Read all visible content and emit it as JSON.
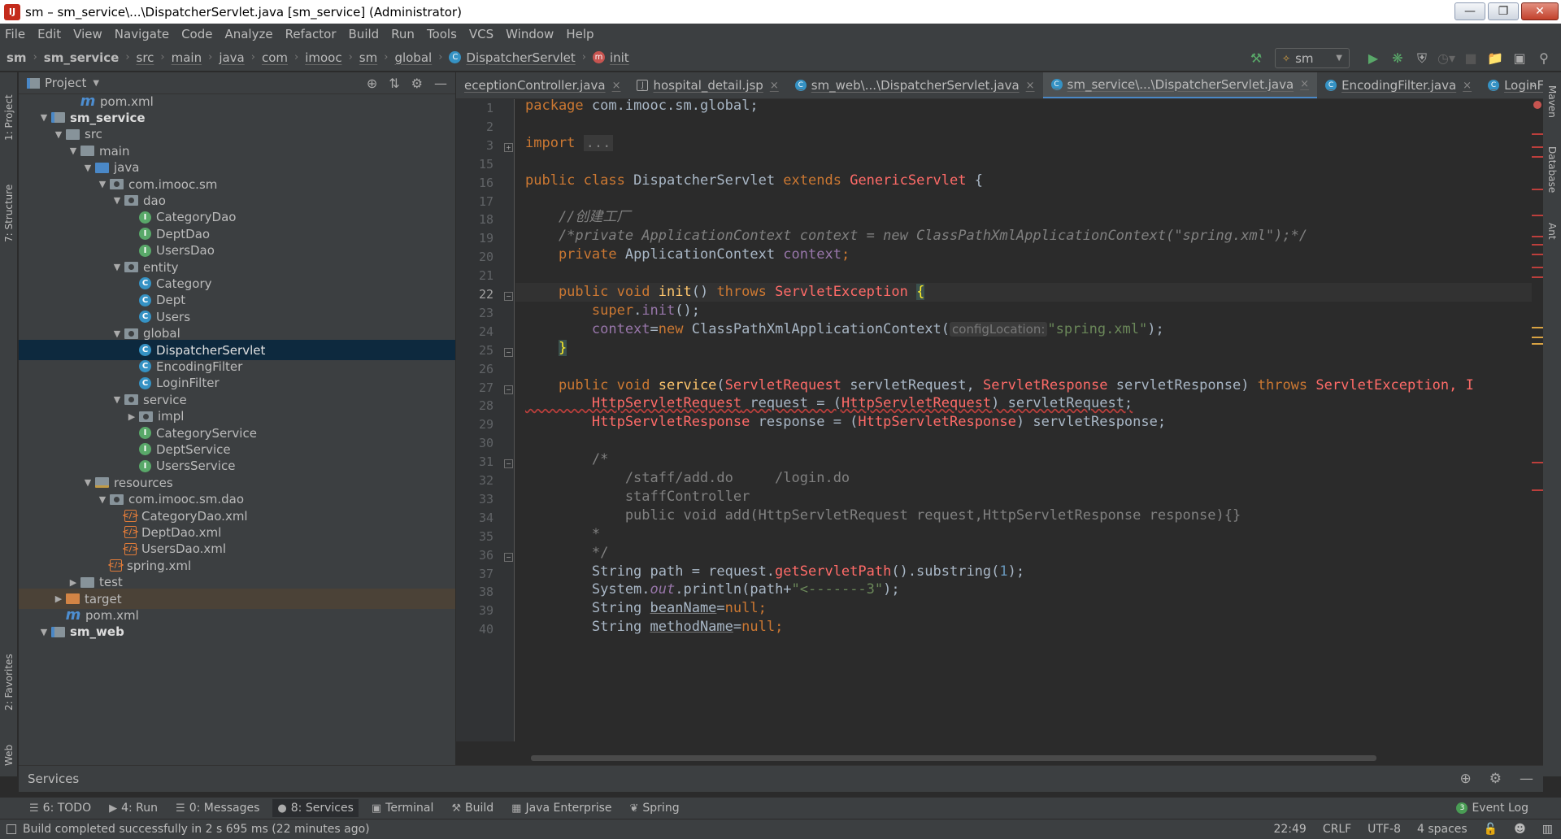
{
  "window": {
    "title": "sm – sm_service\\...\\DispatcherServlet.java [sm_service] (Administrator)",
    "app_icon": "IJ"
  },
  "menu": [
    "File",
    "Edit",
    "View",
    "Navigate",
    "Code",
    "Analyze",
    "Refactor",
    "Build",
    "Run",
    "Tools",
    "VCS",
    "Window",
    "Help"
  ],
  "breadcrumbs": [
    "sm",
    "sm_service",
    "src",
    "main",
    "java",
    "com",
    "imooc",
    "sm",
    "global",
    "DispatcherServlet",
    "init"
  ],
  "run_config": "sm",
  "project_panel": {
    "title": "Project"
  },
  "tree": [
    {
      "indent": 3,
      "icon": "mvn",
      "label": "pom.xml"
    },
    {
      "indent": 1,
      "icon": "mod",
      "label": "sm_service",
      "arrow": "▼",
      "bold": true
    },
    {
      "indent": 2,
      "icon": "folder",
      "label": "src",
      "arrow": "▼"
    },
    {
      "indent": 3,
      "icon": "folder",
      "label": "main",
      "arrow": "▼"
    },
    {
      "indent": 4,
      "icon": "srcf",
      "label": "java",
      "arrow": "▼"
    },
    {
      "indent": 5,
      "icon": "pkg",
      "label": "com.imooc.sm",
      "arrow": "▼"
    },
    {
      "indent": 6,
      "icon": "pkg",
      "label": "dao",
      "arrow": "▼"
    },
    {
      "indent": 7,
      "icon": "itf",
      "label": "CategoryDao"
    },
    {
      "indent": 7,
      "icon": "itf",
      "label": "DeptDao"
    },
    {
      "indent": 7,
      "icon": "itf",
      "label": "UsersDao"
    },
    {
      "indent": 6,
      "icon": "pkg",
      "label": "entity",
      "arrow": "▼"
    },
    {
      "indent": 7,
      "icon": "cls",
      "label": "Category"
    },
    {
      "indent": 7,
      "icon": "cls",
      "label": "Dept"
    },
    {
      "indent": 7,
      "icon": "cls",
      "label": "Users"
    },
    {
      "indent": 6,
      "icon": "pkg",
      "label": "global",
      "arrow": "▼"
    },
    {
      "indent": 7,
      "icon": "cls",
      "label": "DispatcherServlet",
      "selected": true
    },
    {
      "indent": 7,
      "icon": "cls",
      "label": "EncodingFilter"
    },
    {
      "indent": 7,
      "icon": "cls",
      "label": "LoginFilter"
    },
    {
      "indent": 6,
      "icon": "pkg",
      "label": "service",
      "arrow": "▼"
    },
    {
      "indent": 7,
      "icon": "pkg",
      "label": "impl",
      "arrow": "▶"
    },
    {
      "indent": 7,
      "icon": "itf",
      "label": "CategoryService"
    },
    {
      "indent": 7,
      "icon": "itf",
      "label": "DeptService"
    },
    {
      "indent": 7,
      "icon": "itf",
      "label": "UsersService"
    },
    {
      "indent": 4,
      "icon": "resf",
      "label": "resources",
      "arrow": "▼"
    },
    {
      "indent": 5,
      "icon": "pkg",
      "label": "com.imooc.sm.dao",
      "arrow": "▼"
    },
    {
      "indent": 6,
      "icon": "xml",
      "label": "CategoryDao.xml"
    },
    {
      "indent": 6,
      "icon": "xml",
      "label": "DeptDao.xml"
    },
    {
      "indent": 6,
      "icon": "xml",
      "label": "UsersDao.xml"
    },
    {
      "indent": 5,
      "icon": "xml",
      "label": "spring.xml"
    },
    {
      "indent": 3,
      "icon": "folder",
      "label": "test",
      "arrow": "▶"
    },
    {
      "indent": 2,
      "icon": "orange",
      "label": "target",
      "arrow": "▶",
      "highlight": true
    },
    {
      "indent": 2,
      "icon": "mvn",
      "label": "pom.xml"
    },
    {
      "indent": 1,
      "icon": "mod",
      "label": "sm_web",
      "arrow": "▼",
      "bold": true
    }
  ],
  "editor_tabs": [
    {
      "label": "eceptionController.java",
      "icon": "C"
    },
    {
      "label": "hospital_detail.jsp",
      "icon": "jsp"
    },
    {
      "label": "sm_web\\...\\DispatcherServlet.java",
      "icon": "C"
    },
    {
      "label": "sm_service\\...\\DispatcherServlet.java",
      "icon": "C",
      "active": true
    },
    {
      "label": "EncodingFilter.java",
      "icon": "C"
    },
    {
      "label": "LoginFilter.java",
      "icon": "C"
    }
  ],
  "line_numbers": [
    "1",
    "2",
    "3",
    "15",
    "16",
    "17",
    "18",
    "19",
    "20",
    "21",
    "22",
    "23",
    "24",
    "25",
    "26",
    "27",
    "28",
    "29",
    "30",
    "31",
    "32",
    "33",
    "34",
    "35",
    "36",
    "37",
    "38",
    "39",
    "40"
  ],
  "code": {
    "l1_kw": "package",
    "l1_rest": " com.imooc.sm.global;",
    "l3_kw": "import",
    "l3_dots": "...",
    "l16_a": "public class",
    "l16_b": " DispatcherServlet ",
    "l16_c": "extends",
    "l16_d": "GenericServlet",
    "l16_e": " {",
    "l18": "    //创建工厂",
    "l19": "    /*private ApplicationContext context = new ClassPathXmlApplicationContext(\"spring.xml\");*/",
    "l20_kw": "    private",
    "l20_type": " ApplicationContext ",
    "l20_fld": "context",
    ";": ";",
    "l22_kw": "    public void ",
    "l22_fn": "init",
    "l22_p": "() ",
    "l22_kw2": "throws ",
    "l22_ex": "ServletException ",
    "l22_br": "{",
    "l23_kw": "        super",
    "l23_dot": ".",
    "l23_fn": "init",
    "l23_p": "();",
    "l24_fld": "        context",
    "l24_eq": "=",
    "l24_kw": "new ",
    "l24_cls": "ClassPathXmlApplicationContext(",
    "l24_hint": "configLocation:",
    "l24_str": "\"spring.xml\"",
    "l24_end": ");",
    "l25_br": "}",
    "l27_kw": "    public void ",
    "l27_fn": "service",
    "l27_p1": "(",
    "l27_t1": "ServletRequest",
    "l27_v1": " servletRequest, ",
    "l27_t2": "ServletResponse",
    "l27_v2": " servletResponse) ",
    "l27_kw2": "throws ",
    "l27_ex": "ServletException, I",
    "l28_t": "        HttpServletRequest",
    "l28_v": " request = (",
    "l28_t2": "HttpServletRequest",
    "l28_v2": ") servletRequest;",
    "l29_t": "        HttpServletResponse",
    "l29_v": " response = (",
    "l29_t2": "HttpServletResponse",
    "l29_v2": ") servletResponse;",
    "l31": "        /*",
    "l32": "            /staff/add.do     /login.do",
    "l33": "            staffController",
    "l34": "            public void add(HttpServletRequest request,HttpServletResponse response){}",
    "l35": "        *",
    "l36": "        */",
    "l37_a": "        String path = request.",
    "l37_fn": "getServletPath",
    "l37_b": "().substring(",
    "l37_n": "1",
    "l37_c": ");",
    "l38_a": "        System.",
    "l38_f": "out",
    "l38_b": ".println(path+",
    "l38_s": "\"<-------3\"",
    "l38_c": ");",
    "l39_a": "        String ",
    "l39_v": "beanName",
    "l39_b": "=",
    "l39_n": "null",
    "l40_a": "        String ",
    "l40_v": "methodName",
    "l40_b": "=",
    "l40_n": "null",
    "l40_c": ";"
  },
  "left_tool_tabs": [
    "1: Project",
    "7: Structure",
    "2: Favorites",
    "Web"
  ],
  "right_tool_tabs": [
    "Maven",
    "Database",
    "Ant"
  ],
  "services_bar": {
    "title": "Services"
  },
  "bottom_tabs": [
    {
      "label": "6: TODO",
      "icon": "☰"
    },
    {
      "label": "4: Run",
      "icon": "▶"
    },
    {
      "label": "0: Messages",
      "icon": "☰"
    },
    {
      "label": "8: Services",
      "icon": "●",
      "active": true
    },
    {
      "label": "Terminal",
      "icon": "▣"
    },
    {
      "label": "Build",
      "icon": "⚒"
    },
    {
      "label": "Java Enterprise",
      "icon": "▦"
    },
    {
      "label": "Spring",
      "icon": "❦"
    }
  ],
  "event_log": {
    "label": "Event Log",
    "badge": "3"
  },
  "status": {
    "message": "Build completed successfully in 2 s 695 ms (22 minutes ago)",
    "position": "22:49",
    "line_sep": "CRLF",
    "encoding": "UTF-8",
    "indent": "4 spaces"
  },
  "colors": {
    "keyword": "#cc7832",
    "string": "#6a8759",
    "field": "#9876aa",
    "function": "#ffc66d",
    "comment": "#808080",
    "error": "#ff6b68",
    "selection": "#0d293e"
  }
}
